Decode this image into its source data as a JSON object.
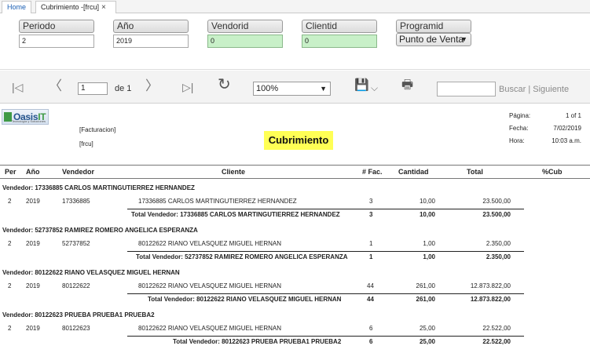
{
  "tabs": [
    {
      "label": "Home"
    },
    {
      "label": "Cubrimiento -[frcu]",
      "close": "×"
    }
  ],
  "params": {
    "periodo": {
      "label": "Periodo",
      "value": "2"
    },
    "anio": {
      "label": "Año",
      "value": "2019"
    },
    "vendorid": {
      "label": "Vendorid",
      "value": "0"
    },
    "clientid": {
      "label": "Clientid",
      "value": "0"
    },
    "programid": {
      "label": "Programid",
      "value": "Punto de Venta"
    }
  },
  "toolbar": {
    "first": "|◁",
    "prev": "〈",
    "page_value": "1",
    "page_of": "de 1",
    "next": "〉",
    "last": "▷|",
    "refresh": "↻",
    "zoom": "100%",
    "save": "💾",
    "save_dropdown": "⌵",
    "print": "🖶",
    "search_placeholder": "",
    "find": "Buscar",
    "separator": "|",
    "find_next": "Siguiente"
  },
  "report": {
    "logo_text_a": "Oasis",
    "logo_text_b": "IT",
    "logo_sub": "Tecnología y Soluciones",
    "line1": "[Facturacion]",
    "line2": "[frcu]",
    "title": "Cubrimiento",
    "meta": {
      "page_label": "Página:",
      "page_value": "1 of 1",
      "date_label": "Fecha:",
      "date_value": "7/02/2019",
      "time_label": "Hora:",
      "time_value": "10:03 a.m."
    },
    "columns": [
      "Per",
      "Año",
      "Vendedor",
      "Cliente",
      "# Fac.",
      "Cantidad",
      "Total",
      "%Cub"
    ],
    "groups": [
      {
        "header": "Vendedor: 17336885 CARLOS MARTINGUTIERREZ HERNANDEZ",
        "row": {
          "per": "2",
          "anio": "2019",
          "vendedor": "17336885",
          "cliente": "17336885  CARLOS MARTINGUTIERREZ HERNANDEZ",
          "fac": "3",
          "cantidad": "10,00",
          "total": "23.500,00"
        },
        "total": {
          "label": "Total Vendedor: 17336885 CARLOS MARTINGUTIERREZ HERNANDEZ",
          "fac": "3",
          "cantidad": "10,00",
          "total": "23.500,00"
        }
      },
      {
        "header": "Vendedor: 52737852 RAMIREZ ROMERO ANGELICA ESPERANZA",
        "row": {
          "per": "2",
          "anio": "2019",
          "vendedor": "52737852",
          "cliente": "80122622  RIANO VELASQUEZ MIGUEL HERNAN",
          "fac": "1",
          "cantidad": "1,00",
          "total": "2.350,00"
        },
        "total": {
          "label": "Total Vendedor: 52737852 RAMIREZ ROMERO ANGELICA ESPERANZA",
          "fac": "1",
          "cantidad": "1,00",
          "total": "2.350,00"
        }
      },
      {
        "header": "Vendedor: 80122622 RIANO VELASQUEZ MIGUEL HERNAN",
        "row": {
          "per": "2",
          "anio": "2019",
          "vendedor": "80122622",
          "cliente": "80122622  RIANO VELASQUEZ MIGUEL HERNAN",
          "fac": "44",
          "cantidad": "261,00",
          "total": "12.873.822,00"
        },
        "total": {
          "label": "Total Vendedor: 80122622 RIANO VELASQUEZ MIGUEL HERNAN",
          "fac": "44",
          "cantidad": "261,00",
          "total": "12.873.822,00"
        }
      },
      {
        "header": "Vendedor: 80122623 PRUEBA PRUEBA1 PRUEBA2",
        "row": {
          "per": "2",
          "anio": "2019",
          "vendedor": "80122623",
          "cliente": "80122622  RIANO VELASQUEZ MIGUEL HERNAN",
          "fac": "6",
          "cantidad": "25,00",
          "total": "22.522,00"
        },
        "total": {
          "label": "Total Vendedor: 80122623 PRUEBA PRUEBA1 PRUEBA2",
          "fac": "6",
          "cantidad": "25,00",
          "total": "22.522,00"
        }
      }
    ]
  }
}
